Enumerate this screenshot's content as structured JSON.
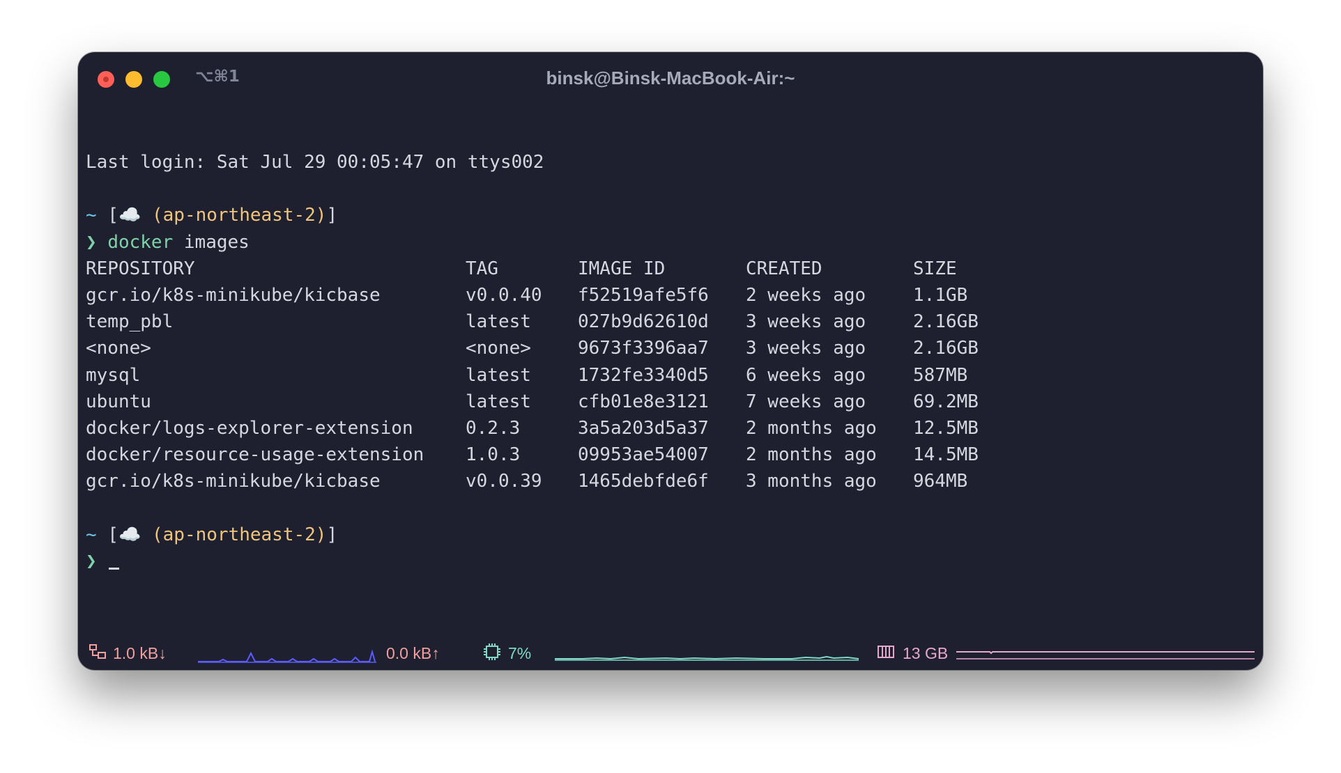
{
  "window": {
    "title": "binsk@Binsk-MacBook-Air:~",
    "shortcut": "⌥⌘1"
  },
  "terminal": {
    "last_login": "Last login: Sat Jul 29 00:05:47 on ttys002",
    "prompt": {
      "tilde": "~",
      "open_bracket": "[",
      "cloud": "☁️",
      "region": "(ap-northeast-2)",
      "close_bracket": "]",
      "chevron": "❯"
    },
    "command": {
      "program": "docker",
      "args": "images"
    },
    "table": {
      "headers": [
        "REPOSITORY",
        "TAG",
        "IMAGE ID",
        "CREATED",
        "SIZE"
      ],
      "rows": [
        [
          "gcr.io/k8s-minikube/kicbase",
          "v0.0.40",
          "f52519afe5f6",
          "2 weeks ago",
          "1.1GB"
        ],
        [
          "temp_pbl",
          "latest",
          "027b9d62610d",
          "3 weeks ago",
          "2.16GB"
        ],
        [
          "<none>",
          "<none>",
          "9673f3396aa7",
          "3 weeks ago",
          "2.16GB"
        ],
        [
          "mysql",
          "latest",
          "1732fe3340d5",
          "6 weeks ago",
          "587MB"
        ],
        [
          "ubuntu",
          "latest",
          "cfb01e8e3121",
          "7 weeks ago",
          "69.2MB"
        ],
        [
          "docker/logs-explorer-extension",
          "0.2.3",
          "3a5a203d5a37",
          "2 months ago",
          "12.5MB"
        ],
        [
          "docker/resource-usage-extension",
          "1.0.3",
          "09953ae54007",
          "2 months ago",
          "14.5MB"
        ],
        [
          "gcr.io/k8s-minikube/kicbase",
          "v0.0.39",
          "1465debfde6f",
          "3 months ago",
          "964MB"
        ]
      ]
    }
  },
  "status": {
    "network_down": "1.0 kB↓",
    "network_up": "0.0 kB↑",
    "cpu": "7%",
    "memory": "13 GB",
    "icons": {
      "network": "network-icon",
      "cpu": "cpu-chip-icon",
      "memory": "memory-icon"
    },
    "colors": {
      "network": "#f29f9f",
      "cpu": "#7fd9c4",
      "memory": "#e8a8cc"
    }
  }
}
